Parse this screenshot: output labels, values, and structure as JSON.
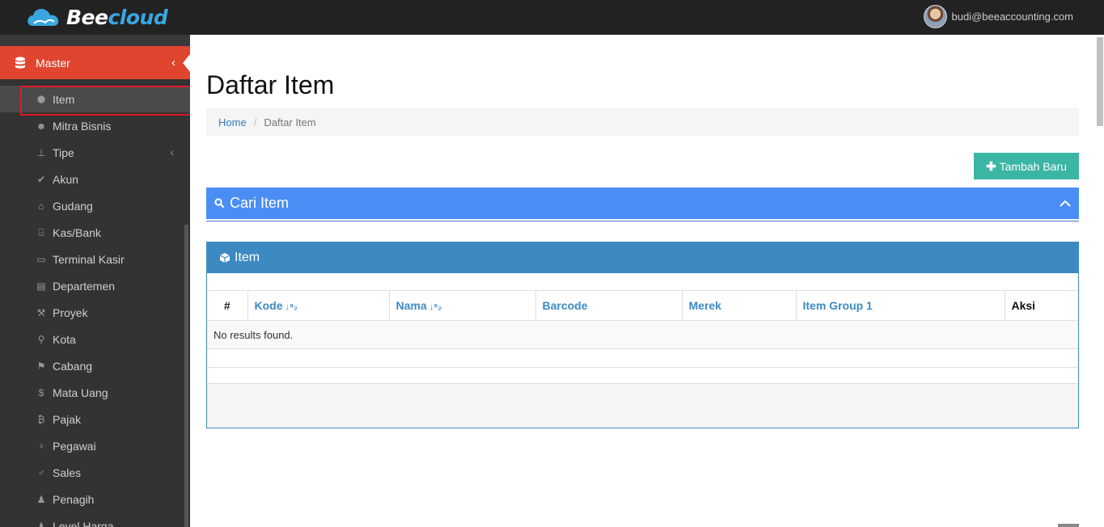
{
  "app": {
    "brand_part1": "Bee",
    "brand_part2": "cloud",
    "user_email": "budi@beeaccounting.com"
  },
  "sidebar": {
    "section_label": "Master",
    "items": [
      {
        "label": "Item",
        "icon": "cube-icon"
      },
      {
        "label": "Mitra Bisnis",
        "icon": "users-icon"
      },
      {
        "label": "Tipe",
        "icon": "sitemap-icon"
      },
      {
        "label": "Akun",
        "icon": "check-icon"
      },
      {
        "label": "Gudang",
        "icon": "home-icon"
      },
      {
        "label": "Kas/Bank",
        "icon": "bank-icon"
      },
      {
        "label": "Terminal Kasir",
        "icon": "desktop-icon"
      },
      {
        "label": "Departemen",
        "icon": "building-icon"
      },
      {
        "label": "Proyek",
        "icon": "gavel-icon"
      },
      {
        "label": "Kota",
        "icon": "map-marker-icon"
      },
      {
        "label": "Cabang",
        "icon": "flag-icon"
      },
      {
        "label": "Mata Uang",
        "icon": "dollar-icon"
      },
      {
        "label": "Pajak",
        "icon": "bitcoin-icon"
      },
      {
        "label": "Pegawai",
        "icon": "person-icon"
      },
      {
        "label": "Sales",
        "icon": "male-icon"
      },
      {
        "label": "Penagih",
        "icon": "user-tie-icon"
      },
      {
        "label": "Level Harga",
        "icon": "tag-icon"
      }
    ]
  },
  "page": {
    "title": "Daftar Item",
    "breadcrumb_home": "Home",
    "breadcrumb_sep": "/",
    "breadcrumb_current": "Daftar Item",
    "add_button": "Tambah Baru",
    "search_panel_title": "Cari Item",
    "item_panel_title": "Item"
  },
  "table": {
    "columns": [
      "#",
      "Kode",
      "Nama",
      "Barcode",
      "Merek",
      "Item Group 1",
      "Aksi"
    ],
    "empty_message": "No results found."
  },
  "colors": {
    "accent_red": "#e0452f",
    "search_blue": "#4a8ef5",
    "panel_blue": "#3d8ac2",
    "button_teal": "#3bb5a4"
  }
}
